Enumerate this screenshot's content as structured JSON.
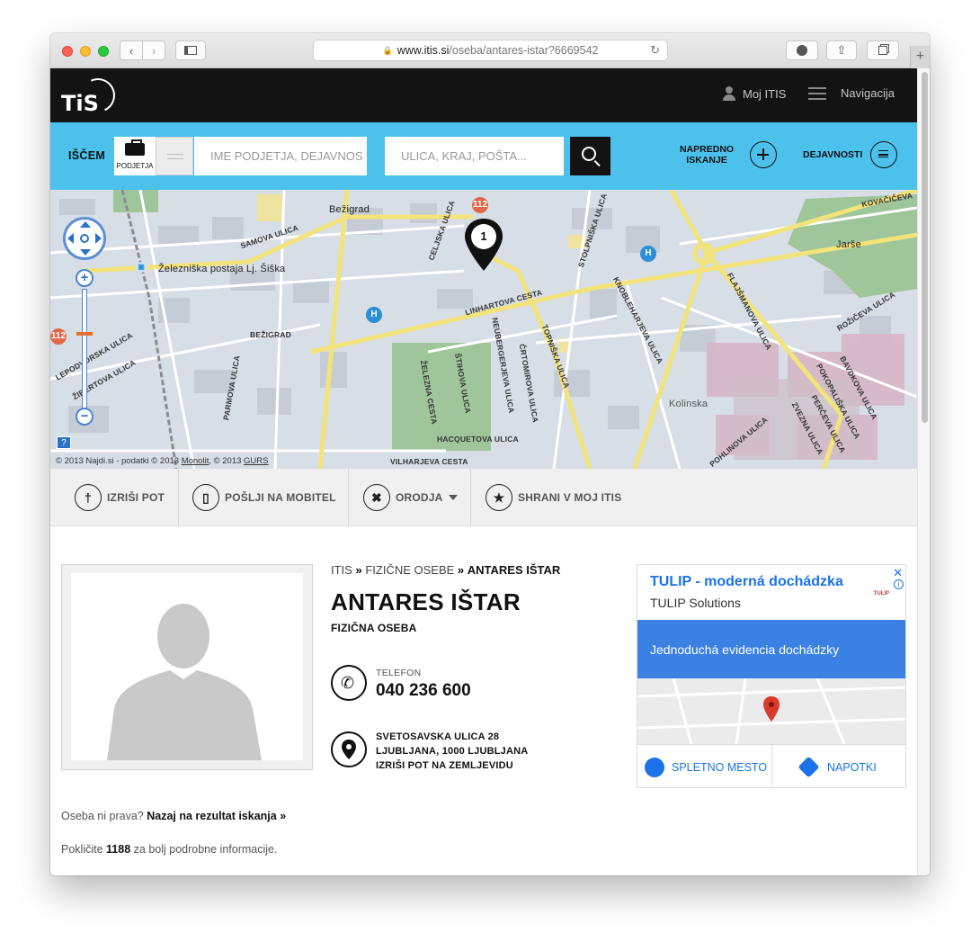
{
  "browser": {
    "url_host": "www.itis.si",
    "url_path": "/oseba/antares-istar?6669542"
  },
  "header": {
    "logo": "TiS",
    "moj_itis": "Moj ITIS",
    "navigation": "Navigacija"
  },
  "search": {
    "label": "IŠČEM",
    "type_label": "PODJETJA",
    "company_placeholder": "IME PODJETJA, DEJAVNOS",
    "location_placeholder": "ULICA, KRAJ, POŠTA...",
    "advanced_label_line1": "NAPREDNO",
    "advanced_label_line2": "ISKANJE",
    "activities_label": "DEJAVNOSTI"
  },
  "map": {
    "marker_number": "1",
    "copyright_prefix": "© 2013 Najdi.si - podatki © 2013 ",
    "copyright_monolit": "Monolit",
    "copyright_mid": ", © 2013 ",
    "copyright_gurs": "GURS",
    "labels": {
      "bezigrad_top": "Bežigrad",
      "zel_postaja": "Železniška postaja Lj. Šiška",
      "samova": "SAMOVA ULICA",
      "linhartova": "LINHARTOVA CESTA",
      "celjska": "CELJSKA ULICA",
      "stolpniska": "STOLPNIŠKA ULICA",
      "bezigrad_street": "BEŽIGRAD",
      "jarse": "Jarše",
      "kovaciceva": "KOVAČIČEVA",
      "kolinska": "Kolinska",
      "vilharjeva": "VILHARJEVA CESTA",
      "hacquetova": "HACQUETOVA ULICA",
      "zelezna": "ŽELEZNA CESTA",
      "stihova": "ŠTIHOVA ULICA",
      "neubergerjeva": "NEUBERGERJEVA ULICA",
      "crtomirova": "ČRTOMIROVA ULICA",
      "topniska": "TOPNIŠKA ULICA",
      "knobleharjeva": "KNOBLEHARJEVA ULICA",
      "flajsmanova": "FLAJŠMANOVA ULICA",
      "rozniceva": "ROŽIČEVA ULICA",
      "savinskova": "BAVDKOVA ULICA",
      "pokopaliska": "POKOPALIŠKA ULICA",
      "perceva": "PERČEVA ULICA",
      "zvezna": "ZVEZNA ULICA",
      "pohlinova": "POHLINOVA ULICA",
      "parmova": "PARMOVA ULICA",
      "leporska": "LEPODVORSKA ULICA",
      "zibertova": "ŽIBERTOVA ULICA"
    }
  },
  "toolbar": {
    "route": "IZRIŠI POT",
    "send_mobile": "POŠLJI NA MOBITEL",
    "tools": "ORODJA",
    "save": "SHRANI V MOJ ITIS"
  },
  "person": {
    "breadcrumb_root": "ITIS",
    "breadcrumb_sep": "»",
    "breadcrumb_category": "FIZIČNE OSEBE",
    "breadcrumb_current": "ANTARES IŠTAR",
    "name": "ANTARES IŠTAR",
    "type": "FIZIČNA OSEBA",
    "phone_label": "TELEFON",
    "phone": "040 236 600",
    "address_line1": "SVETOSAVSKA ULICA 28",
    "address_line2": "LJUBLJANA, 1000 LJUBLJANA",
    "address_route": "IZRIŠI POT NA ZEMLJEVIDU"
  },
  "notes": {
    "wrong_prefix": "Oseba ni prava?",
    "wrong_link": "Nazaj na rezultat iskanja »",
    "call_prefix": "Pokličite",
    "call_number": "1188",
    "call_suffix": "za bolj podrobne informacije."
  },
  "ad": {
    "title": "TULIP - moderná dochádzka",
    "advertiser": "TULIP Solutions",
    "brand": "TULIP",
    "banner": "Jednoduchá evidencia dochádzky",
    "website_button": "SPLETNO MESTO",
    "directions_button": "NAPOTKI"
  }
}
